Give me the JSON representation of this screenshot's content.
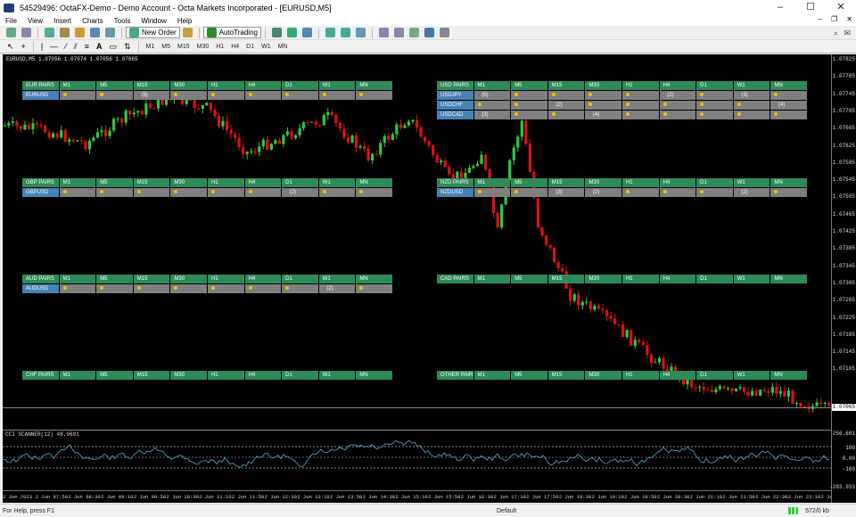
{
  "window": {
    "title": "54529496: OctaFX-Demo - Demo Account - Octa Markets Incorporated - [EURUSD,M5]",
    "minimize": "–",
    "maximize": "☐",
    "close": "✕"
  },
  "menu": [
    "File",
    "View",
    "Insert",
    "Charts",
    "Tools",
    "Window",
    "Help"
  ],
  "toolbar": {
    "new_order": "New Order",
    "autotrading": "AutoTrading"
  },
  "timeframes": [
    "M1",
    "M5",
    "M15",
    "M30",
    "H1",
    "H4",
    "D1",
    "W1",
    "MN"
  ],
  "chart": {
    "title": "EURUSD,M5  1.07056 1.07074 1.07056 1.07065",
    "current_price": "1.07065",
    "price_labels": [
      "1.07825",
      "1.07785",
      "1.07745",
      "1.07705",
      "1.07665",
      "1.07625",
      "1.07585",
      "1.07545",
      "1.07505",
      "1.07465",
      "1.07425",
      "1.07385",
      "1.07345",
      "1.07305",
      "1.07265",
      "1.07225",
      "1.07185",
      "1.07145",
      "1.07105"
    ],
    "time_labels": [
      "2 Jun 2023",
      "2 Jun 07:50",
      "2 Jun 08:30",
      "2 Jun 09:10",
      "2 Jun 09:50",
      "2 Jun 10:30",
      "2 Jun 11:10",
      "2 Jun 11:50",
      "2 Jun 12:30",
      "2 Jun 13:10",
      "2 Jun 13:50",
      "2 Jun 14:30",
      "2 Jun 15:10",
      "2 Jun 15:50",
      "2 Jun 16:30",
      "2 Jun 17:10",
      "2 Jun 17:50",
      "2 Jun 18:30",
      "2 Jun 19:10",
      "2 Jun 19:50",
      "2 Jun 20:30",
      "2 Jun 21:10",
      "2 Jun 21:50",
      "2 Jun 22:30",
      "2 Jun 23:10",
      "2 Jun 23:50"
    ],
    "cci_label": "CCI SCANNER(12) 48.9691",
    "cci_levels": [
      "256.681",
      "100",
      "0.00",
      "-100",
      "-283.933"
    ],
    "colors": {
      "bull": "#2ecc40",
      "bear": "#e01010",
      "cci": "#5aa9d6"
    }
  },
  "panels": {
    "eur": {
      "header": "EUR PAIRS",
      "rows": [
        {
          "pair": "EURUSD",
          "cells": [
            "•",
            "•",
            "↓|(5)",
            "•",
            "•",
            "•",
            "•",
            "•",
            "•"
          ]
        }
      ]
    },
    "gbp": {
      "header": "GBP PAIRS",
      "rows": [
        {
          "pair": "GBPUSD",
          "cells": [
            "•",
            "•",
            "•",
            "•",
            "•",
            "•",
            "↑|(2)",
            "•",
            "•"
          ]
        }
      ]
    },
    "aud": {
      "header": "AUD PAIRS",
      "rows": [
        {
          "pair": "AUDUSD",
          "cells": [
            "•",
            "•",
            "•",
            "•",
            "•",
            "•",
            "•",
            "↓|(2)",
            "•"
          ]
        }
      ]
    },
    "chf": {
      "header": "CHF PAIRS",
      "rows": []
    },
    "usd": {
      "header": "USD PAIRS",
      "rows": [
        {
          "pair": "USDJPY",
          "cells": [
            "↓|(5)",
            "•",
            "•",
            "•",
            "•",
            "↑|(2)",
            "•",
            "↑|(3)",
            "•"
          ]
        },
        {
          "pair": "USDCHF",
          "cells": [
            "•",
            "•",
            "↑|(2)",
            "•",
            "•",
            "•",
            "•",
            "•",
            "↓|(4)"
          ]
        },
        {
          "pair": "USDCAD",
          "cells": [
            "↓|(3)",
            "•",
            "•",
            "↓|(4)",
            "•",
            "•",
            "•",
            "•",
            "•"
          ]
        }
      ]
    },
    "nzd": {
      "header": "NZD PAIRS",
      "rows": [
        {
          "pair": "NZDUSD",
          "cells": [
            "•",
            "•",
            "↓|(3)",
            "↓|(2)",
            "•",
            "•",
            "•",
            "↓|(2)",
            "•"
          ]
        }
      ]
    },
    "cad": {
      "header": "CAD PAIRS",
      "rows": []
    },
    "other": {
      "header": "OTHER PAIRS",
      "rows": []
    }
  },
  "status": {
    "help": "For Help, press F1",
    "profile": "Default",
    "traffic": "572/0 kb"
  }
}
